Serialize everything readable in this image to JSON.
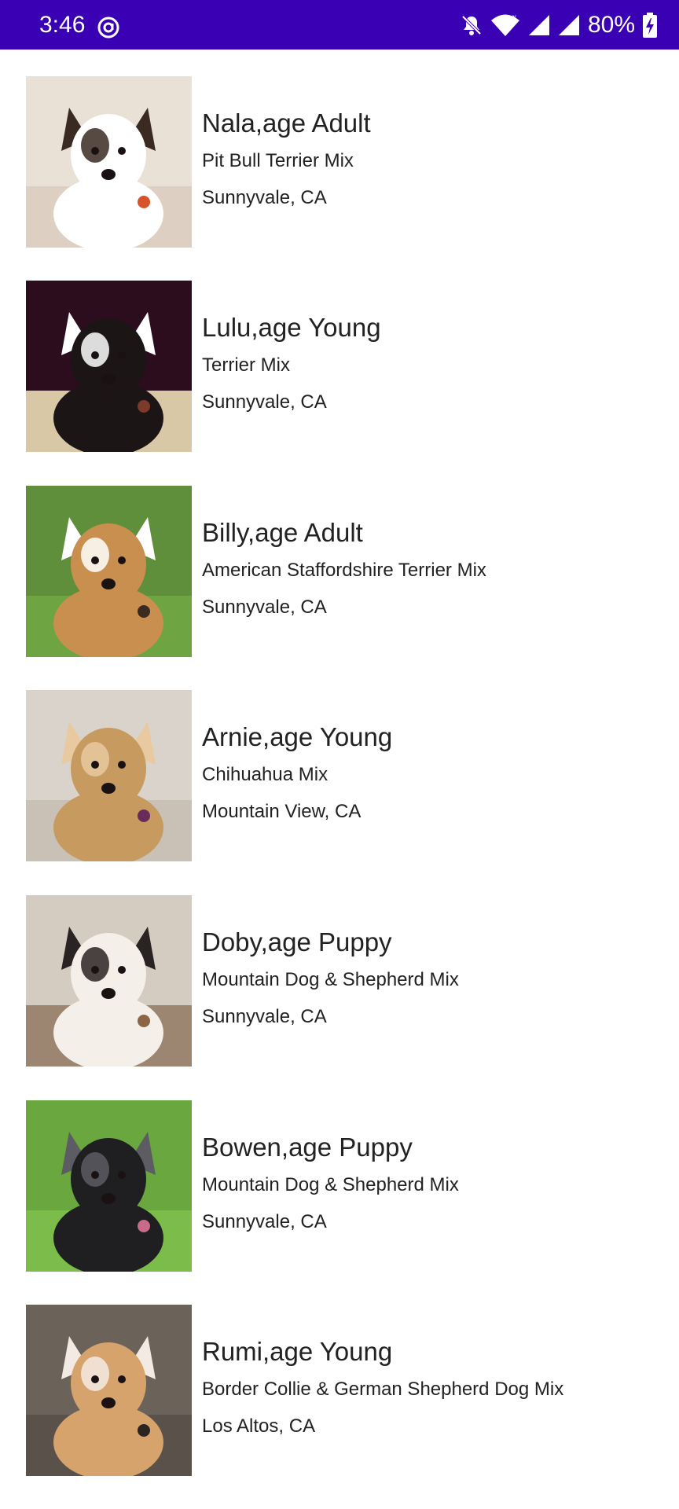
{
  "status_bar": {
    "time": "3:46",
    "battery": "80%",
    "background": "#3a00b4",
    "icons": [
      "at-sign-icon",
      "bell-off-icon",
      "wifi-icon",
      "signal-icon",
      "signal-icon",
      "battery-charging-icon"
    ]
  },
  "pets": [
    {
      "title": "Nala,age Adult",
      "breed": "Pit Bull Terrier Mix",
      "location": "Sunnyvale, CA",
      "photo": {
        "bg": "#e9e0d6",
        "floor": "#ddd0c2",
        "coat": "#ffffff",
        "patch": "#3a2a22",
        "accent": "#d9532a"
      }
    },
    {
      "title": "Lulu,age Young",
      "breed": "Terrier Mix",
      "location": "Sunnyvale, CA",
      "photo": {
        "bg": "#2b0d1e",
        "floor": "#d8c8a6",
        "coat": "#1c1515",
        "patch": "#ffffff",
        "accent": "#7b3a2a"
      }
    },
    {
      "title": "Billy,age Adult",
      "breed": "American Staffordshire Terrier Mix",
      "location": "Sunnyvale, CA",
      "photo": {
        "bg": "#5f8f3a",
        "floor": "#6fa442",
        "coat": "#c98f4e",
        "patch": "#ffffff",
        "accent": "#3a2a22"
      }
    },
    {
      "title": "Arnie,age Young",
      "breed": "Chihuahua Mix",
      "location": "Mountain View, CA",
      "photo": {
        "bg": "#d9d3cb",
        "floor": "#c9c1b6",
        "coat": "#c79a60",
        "patch": "#e8c9a0",
        "accent": "#6a2b5a"
      }
    },
    {
      "title": "Doby,age Puppy",
      "breed": "Mountain Dog & Shepherd Mix",
      "location": "Sunnyvale, CA",
      "photo": {
        "bg": "#d4ccc1",
        "floor": "#9c8672",
        "coat": "#f4efe8",
        "patch": "#2a2323",
        "accent": "#8a6646"
      }
    },
    {
      "title": "Bowen,age Puppy",
      "breed": "Mountain Dog & Shepherd Mix",
      "location": "Sunnyvale, CA",
      "photo": {
        "bg": "#6aa83f",
        "floor": "#7cbc4a",
        "coat": "#1f1f22",
        "patch": "#5c5c62",
        "accent": "#c86a8a"
      }
    },
    {
      "title": "Rumi,age Young",
      "breed": "Border Collie & German Shepherd Dog Mix",
      "location": "Los Altos, CA",
      "photo": {
        "bg": "#6b635a",
        "floor": "#5a524a",
        "coat": "#d7a36c",
        "patch": "#f3ebe3",
        "accent": "#2b2423"
      }
    }
  ]
}
